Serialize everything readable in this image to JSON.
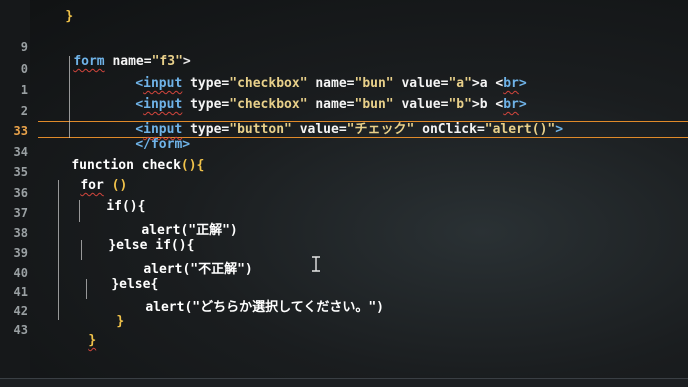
{
  "gutter": {
    "line_numbers": [
      "9",
      "0",
      "1",
      "2",
      "33",
      "34",
      "35",
      "36",
      "37",
      "38",
      "39",
      "40",
      "41",
      "42",
      "43"
    ],
    "current_line": "33"
  },
  "code": {
    "l8": "}",
    "l9": {
      "tag": "form",
      "attr": " name=",
      "val": "\"f3\"",
      "end": ">"
    },
    "l10": {
      "open": "<",
      "tag": "input",
      "a1": " type=",
      "v1": "\"checkbox\"",
      "a2": " name=",
      "v2": "\"bun\"",
      "a3": " value=",
      "v3": "\"a\"",
      "rest": ">a <",
      "br": "br",
      "close": ">"
    },
    "l11": {
      "open": "<",
      "tag": "input",
      "a1": " type=",
      "v1": "\"checkbox\"",
      "a2": " name=",
      "v2": "\"bun\"",
      "a3": " value=",
      "v3": "\"b\"",
      "rest": ">b <",
      "br": "br",
      "close": ">"
    },
    "l12": {
      "open": "<",
      "tag": "input",
      "a1": " type=",
      "v1": "\"button\"",
      "a2": " value=",
      "v2": "\"チェック\"",
      "a3": " onClick=",
      "v3": "\"alert()\"",
      "close": ">"
    },
    "l13": "</form>",
    "l14_kw": "function",
    "l14_name": " check",
    "l14_br": "(){",
    "l15_kw": "for",
    "l15_rest": " ()",
    "l16": "if(){",
    "l17": "alert(\"正解\")",
    "l18": "}else if(){",
    "l19": "alert(\"不正解\")",
    "l20": "}else{",
    "l21": "alert(\"どちらか選択してください。\")",
    "l22": "}",
    "l23": "}"
  }
}
